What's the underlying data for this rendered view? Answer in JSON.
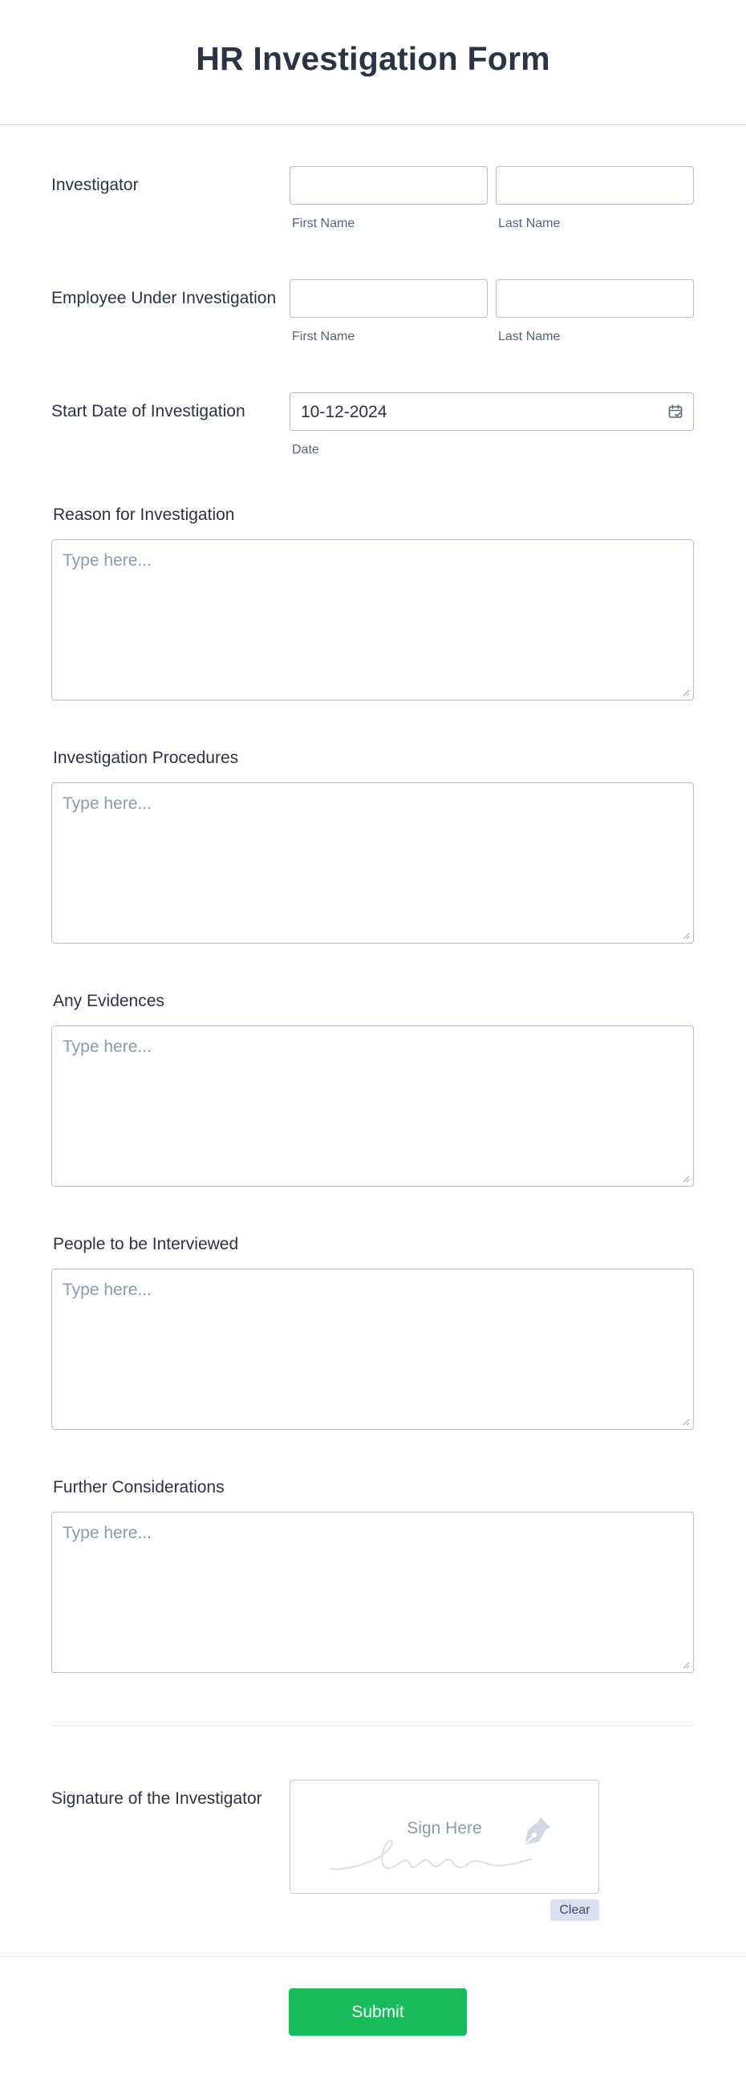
{
  "form": {
    "title": "HR Investigation Form"
  },
  "investigator": {
    "label": "Investigator",
    "first_name_label": "First Name",
    "last_name_label": "Last Name",
    "first_name_value": "",
    "last_name_value": ""
  },
  "employee": {
    "label": "Employee Under Investigation",
    "first_name_label": "First Name",
    "last_name_label": "Last Name",
    "first_name_value": "",
    "last_name_value": ""
  },
  "start_date": {
    "label": "Start Date of Investigation",
    "value": "10-12-2024",
    "sublabel": "Date",
    "icon": "calendar-icon"
  },
  "textareas": [
    {
      "label": "Reason for Investigation",
      "placeholder": "Type here..."
    },
    {
      "label": "Investigation Procedures",
      "placeholder": "Type here..."
    },
    {
      "label": "Any Evidences",
      "placeholder": "Type here..."
    },
    {
      "label": "People to be Interviewed",
      "placeholder": "Type here..."
    },
    {
      "label": "Further Considerations",
      "placeholder": "Type here..."
    }
  ],
  "signature": {
    "label": "Signature of the Investigator",
    "pad_text": "Sign Here",
    "clear_label": "Clear",
    "icon": "pen-nib-icon"
  },
  "footer": {
    "submit_label": "Submit",
    "accent_color": "#18bd5b"
  }
}
